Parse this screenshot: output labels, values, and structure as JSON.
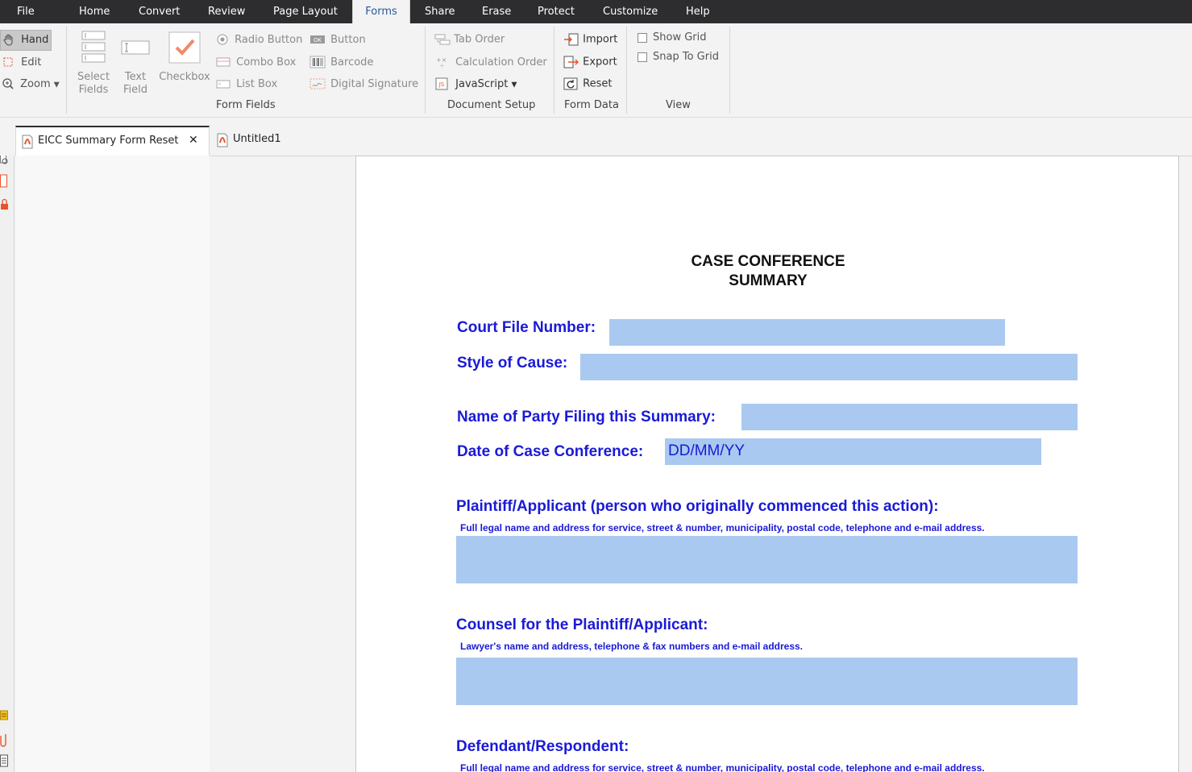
{
  "menu": {
    "items": [
      {
        "label": "File"
      },
      {
        "label": "Home"
      },
      {
        "label": "Convert"
      },
      {
        "label": "Review"
      },
      {
        "label": "Page Layout"
      },
      {
        "label": "Forms"
      },
      {
        "label": "Share"
      },
      {
        "label": "Erase"
      },
      {
        "label": "Protect"
      },
      {
        "label": "Customize"
      },
      {
        "label": "Help"
      }
    ],
    "active": "Forms"
  },
  "ribbon": {
    "tools": {
      "hand": "Hand",
      "edit": "Edit",
      "zoom": "Zoom"
    },
    "form_fields": {
      "select_fields_1": "Select",
      "select_fields_2": "Fields",
      "text_field_1": "Text",
      "text_field_2": "Field",
      "checkbox": "Checkbox",
      "radio_button": "Radio Button",
      "combo_box": "Combo Box",
      "list_box": "List Box",
      "button": "Button",
      "barcode": "Barcode",
      "digital_signature": "Digital Signature",
      "group_label": "Form Fields"
    },
    "document_setup": {
      "tab_order": "Tab Order",
      "calculation_order": "Calculation Order",
      "javascript": "JavaScript",
      "group_label": "Document Setup"
    },
    "form_data": {
      "import": "Import",
      "export": "Export",
      "reset": "Reset",
      "group_label": "Form Data"
    },
    "view": {
      "show_grid": "Show Grid",
      "snap_to_grid": "Snap To Grid",
      "group_label": "View"
    }
  },
  "tabs": [
    {
      "label": "EICC Summary Form Reset",
      "active": true
    },
    {
      "label": "Untitled1",
      "active": false
    }
  ],
  "document": {
    "title_line1": "CASE CONFERENCE",
    "title_line2": "SUMMARY",
    "court_file_label": "Court File Number:",
    "style_of_cause_label": "Style of Cause:",
    "party_filing_label": "Name of Party Filing this Summary:",
    "date_label": "Date of Case Conference:",
    "date_value": "DD/MM/YY",
    "plaintiff_label": "Plaintiff/Applicant (person who originally commenced this action):",
    "plaintiff_hint": "Full legal name and address for service, street & number, municipality, postal code, telephone and e-mail address.",
    "counsel_label": "Counsel for the Plaintiff/Applicant:",
    "counsel_hint": "Lawyer's name and address, telephone & fax numbers and e-mail address.",
    "defendant_label": "Defendant/Respondent:",
    "defendant_hint": "Full legal name and address for service, street & number, municipality, postal code, telephone and e-mail address."
  },
  "colors": {
    "menubar": "#2d2d30",
    "form_label": "#1a1ad6",
    "field_fill": "#a9c9f0",
    "accent_icon": "#e8532b"
  }
}
